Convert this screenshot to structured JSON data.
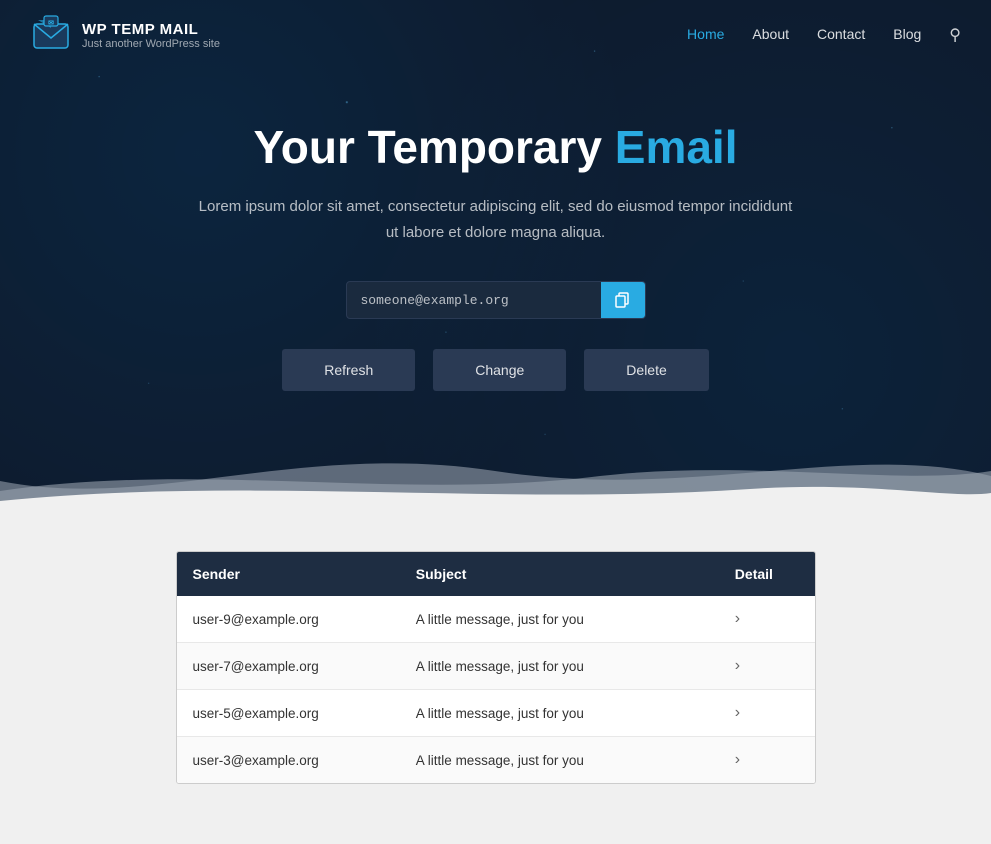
{
  "site": {
    "name": "WP TEMP MAIL",
    "tagline": "Just another WordPress site"
  },
  "nav": {
    "links": [
      {
        "label": "Home",
        "active": true
      },
      {
        "label": "About",
        "active": false
      },
      {
        "label": "Contact",
        "active": false
      },
      {
        "label": "Blog",
        "active": false
      }
    ]
  },
  "hero": {
    "title_static": "Your Temporary",
    "title_accent": "Email",
    "subtitle": "Lorem ipsum dolor sit amet, consectetur adipiscing elit, sed do eiusmod tempor incididunt ut labore et dolore magna aliqua.",
    "email_value": "someone@example.org",
    "copy_icon": "⊞",
    "buttons": [
      {
        "label": "Refresh",
        "id": "refresh"
      },
      {
        "label": "Change",
        "id": "change"
      },
      {
        "label": "Delete",
        "id": "delete"
      }
    ]
  },
  "inbox": {
    "columns": [
      {
        "label": "Sender",
        "key": "sender"
      },
      {
        "label": "Subject",
        "key": "subject"
      },
      {
        "label": "Detail",
        "key": "detail"
      }
    ],
    "rows": [
      {
        "sender": "user-9@example.org",
        "subject": "A little message, just for you",
        "detail": "›"
      },
      {
        "sender": "user-7@example.org",
        "subject": "A little message, just for you",
        "detail": "›"
      },
      {
        "sender": "user-5@example.org",
        "subject": "A little message, just for you",
        "detail": "›"
      },
      {
        "sender": "user-3@example.org",
        "subject": "A little message, just for you",
        "detail": "›"
      }
    ]
  },
  "colors": {
    "accent": "#29abe2",
    "hero_bg": "#0d1b2e",
    "nav_dark": "#1e2d42"
  }
}
